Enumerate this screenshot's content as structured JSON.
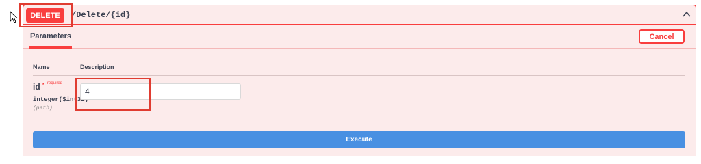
{
  "operation": {
    "method": "DELETE",
    "path": "/Delete/{id}",
    "collapse_icon": "chevron-up-icon"
  },
  "parameters_section": {
    "tab_label": "Parameters",
    "cancel_label": "Cancel",
    "columns": {
      "name": "Name",
      "description": "Description"
    }
  },
  "params": [
    {
      "name": "id",
      "required_marker": "*",
      "required_label": "required",
      "type": "integer($int32)",
      "in": "(path)",
      "value": "4"
    }
  ],
  "execute_label": "Execute",
  "colors": {
    "delete": "#f93e3e",
    "execute": "#4990e2",
    "highlight": "#e03c31",
    "background": "#fcebeb"
  }
}
